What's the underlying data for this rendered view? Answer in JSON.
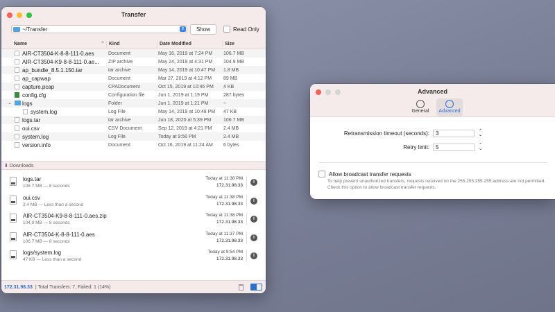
{
  "transfer": {
    "title": "Transfer",
    "path": "~/Transfer",
    "show_label": "Show",
    "read_only_label": "Read Only",
    "columns": {
      "name": "Name",
      "kind": "Kind",
      "date": "Date Modified",
      "size": "Size"
    },
    "files": [
      {
        "name": "AIR-CT3504-K-8-8-111-0.aes",
        "kind": "Document",
        "date": "May 16, 2019 at 7:24 PM",
        "size": "106.7 MB"
      },
      {
        "name": "AIR-CT3504-K9-8-8-111-0.ae...",
        "kind": "ZIP archive",
        "date": "May 24, 2019 at 4:31 PM",
        "size": "104.9 MB"
      },
      {
        "name": "ap_bundle_8.5.1.150.tar",
        "kind": "tar archive",
        "date": "May 14, 2019 at 10:47 PM",
        "size": "1.8 MB"
      },
      {
        "name": "ap_capwap",
        "kind": "Document",
        "date": "Mar 27, 2019 at 4:12 PM",
        "size": "89 MB"
      },
      {
        "name": "capture.pcap",
        "kind": "CPADocument",
        "date": "Oct 15, 2019 at 10:46 PM",
        "size": "4 KB"
      },
      {
        "name": "config.cfg",
        "kind": "Configuration file",
        "date": "Jun 1, 2019 at 1:19 PM",
        "size": "287 bytes"
      },
      {
        "name": "logs",
        "kind": "Folder",
        "date": "Jun 1, 2019 at 1:21 PM",
        "size": "--"
      },
      {
        "name": "system.log",
        "kind": "Log File",
        "date": "May 14, 2019 at 10:48 PM",
        "size": "47 KB"
      },
      {
        "name": "logs.tar",
        "kind": "tar archive",
        "date": "Jun 18, 2020 at 5:39 PM",
        "size": "106.7 MB"
      },
      {
        "name": "oui.csv",
        "kind": "CSV Document",
        "date": "Sep 12, 2019 at 4:21 PM",
        "size": "2.4 MB"
      },
      {
        "name": "system.log",
        "kind": "Log File",
        "date": "Today at 9:56 PM",
        "size": "2.4 MB"
      },
      {
        "name": "version.info",
        "kind": "Document",
        "date": "Oct 16, 2019 at 11:24 AM",
        "size": "6 bytes"
      }
    ],
    "downloads_label": "⬇ Downloads",
    "downloads": [
      {
        "name": "logs.tar",
        "sub": "106.7 MB — 8 seconds",
        "time": "Today at 11:38 PM",
        "ip": "172.31.98.33"
      },
      {
        "name": "oui.csv",
        "sub": "2.4 MB — Less than a second",
        "time": "Today at 11:38 PM",
        "ip": "172.31.98.33"
      },
      {
        "name": "AIR-CT3504-K9-8-8-111-0.aes.zip",
        "sub": "104.9 MB — 8 seconds",
        "time": "Today at 11:38 PM",
        "ip": "172.31.98.33"
      },
      {
        "name": "AIR-CT3504-K-8-8-111-0.aes",
        "sub": "106.7 MB — 8 seconds",
        "time": "Today at 11:37 PM",
        "ip": "172.31.98.33"
      },
      {
        "name": "logs/system.log",
        "sub": "47 KB — Less than a second",
        "time": "Today at 9:54 PM",
        "ip": "172.31.98.33"
      }
    ],
    "status_ip": "172.31.98.33",
    "status_text": "|  Total Transfers: 7, Failed: 1 (14%)"
  },
  "advanced": {
    "title": "Advanced",
    "tabs": {
      "general": "General",
      "advanced": "Advanced"
    },
    "retrans_label": "Retransmission timeout (seconds):",
    "retrans_value": "3",
    "retry_label": "Retry limit:",
    "retry_value": "5",
    "broadcast_label": "Allow broadcast transfer requests",
    "broadcast_desc": "To help prevent unauthorized transfers, requests received on the 255.255.255.255 address are not permitted. Check this option to allow broadcast transfer requests."
  }
}
